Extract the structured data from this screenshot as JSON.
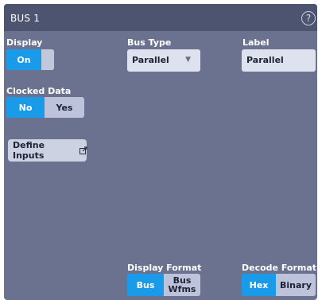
{
  "window": {
    "title": "BUS 1",
    "help_glyph": "?"
  },
  "display": {
    "label": "Display",
    "on_label": "On",
    "off_label": "",
    "selected": "On"
  },
  "clocked_data": {
    "label": "Clocked Data",
    "no_label": "No",
    "yes_label": "Yes",
    "selected": "No"
  },
  "define_inputs": {
    "label": "Define Inputs",
    "icon": "external-link-icon"
  },
  "bus_type": {
    "label": "Bus Type",
    "value": "Parallel"
  },
  "bus_label": {
    "label": "Label",
    "value": "Parallel"
  },
  "display_format": {
    "label": "Display Format",
    "bus_label": "Bus",
    "bus_wfms_label_1": "Bus",
    "bus_wfms_label_2": "Wfms",
    "selected": "Bus"
  },
  "decode_format": {
    "label": "Decode Format",
    "hex_label": "Hex",
    "binary_label": "Binary",
    "selected": "Hex"
  },
  "colors": {
    "accent": "#1a9bea",
    "panel": "#6b7290",
    "titlebar": "#4d5470"
  }
}
